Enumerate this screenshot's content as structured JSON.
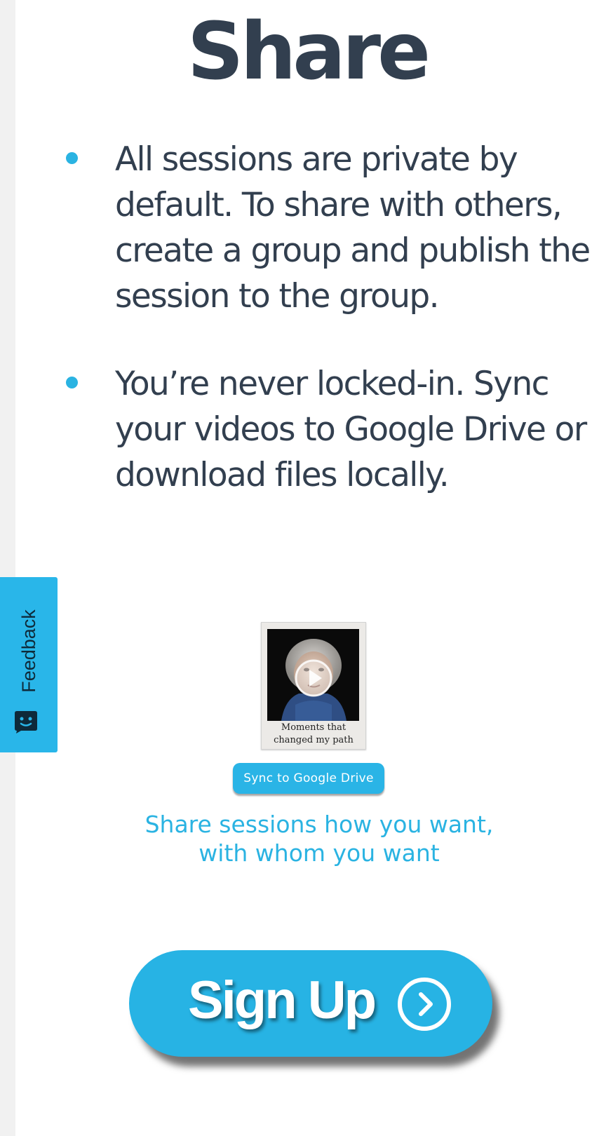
{
  "section": {
    "title": "Share"
  },
  "bullets": [
    "All sessions are private by default. To share with others, create a group and publish the session to the group.",
    "You’re never locked-in. Sync your videos to Google Drive or download files locally."
  ],
  "feedback": {
    "label": "Feedback",
    "icon": "chat-face-icon"
  },
  "demo": {
    "thumbnail_caption_line1": "Moments that",
    "thumbnail_caption_line2": "changed my path",
    "sync_button_label": "Sync to Google Drive",
    "play_icon": "play-icon"
  },
  "tagline": {
    "line1": "Share sessions how you want,",
    "line2": "with whom you want"
  },
  "cta": {
    "label": "Sign Up",
    "icon": "chevron-right-circle-icon"
  },
  "colors": {
    "accent": "#2ab3e2",
    "text_dark": "#323f4f",
    "feedback_tab": "#29b6e9"
  }
}
